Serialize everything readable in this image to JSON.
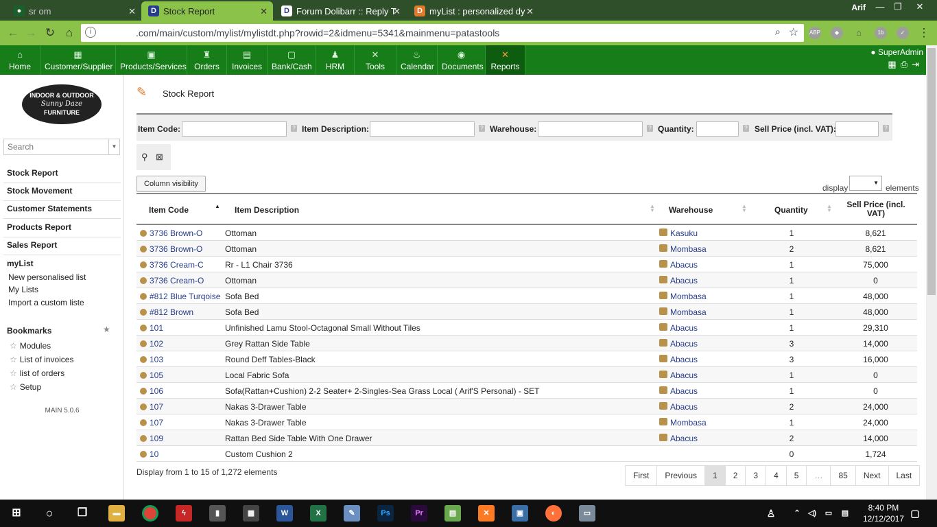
{
  "browser": {
    "tabs": [
      {
        "title": "sr        om"
      },
      {
        "title": "Stock Report"
      },
      {
        "title": "Forum Dolibarr :: Reply T"
      },
      {
        "title": "myList : personalized dy"
      }
    ],
    "user": "Arif",
    "url": ".com/main/custom/mylist/mylistdt.php?rowid=2&idmenu=5341&mainmenu=patastools"
  },
  "topmenu": {
    "items": [
      {
        "label": "Home",
        "icon": "home-icon"
      },
      {
        "label": "Customer/Supplier",
        "icon": "building-icon"
      },
      {
        "label": "Products/Services",
        "icon": "boxes-icon"
      },
      {
        "label": "Orders",
        "icon": "bottle-icon"
      },
      {
        "label": "Invoices",
        "icon": "invoice-icon"
      },
      {
        "label": "Bank/Cash",
        "icon": "safe-icon"
      },
      {
        "label": "HRM",
        "icon": "users-icon"
      },
      {
        "label": "Tools",
        "icon": "tools-icon"
      },
      {
        "label": "Calendar",
        "icon": "calendar-icon"
      },
      {
        "label": "Documents",
        "icon": "documents-icon"
      },
      {
        "label": "Reports",
        "icon": "reports-icon"
      }
    ],
    "user": "SuperAdmin"
  },
  "sidebar": {
    "logo": {
      "line1": "INDOOR & OUTDOOR",
      "line2": "Sunny Daze",
      "line3": "FURNITURE"
    },
    "search_placeholder": "Search",
    "main_items": [
      "Stock Report",
      "Stock Movement",
      "Customer Statements",
      "Products Report",
      "Sales Report"
    ],
    "mylist_title": "myList",
    "mylist_items": [
      "New personalised list",
      "My Lists",
      "Import a custom liste"
    ],
    "bookmarks_title": "Bookmarks",
    "bookmarks": [
      "Modules",
      "List of invoices",
      "list of orders",
      "Setup"
    ],
    "version": "MAIN 5.0.6"
  },
  "page": {
    "title": "Stock Report",
    "filters": {
      "item_code": "Item Code:",
      "item_description": "Item Description:",
      "warehouse": "Warehouse:",
      "quantity": "Quantity:",
      "sell_price": "Sell Price (incl. VAT):"
    },
    "column_visibility": "Column visibility",
    "display_label": "display",
    "elements_label": "elements",
    "columns": {
      "item_code": "Item Code",
      "item_description": "Item Description",
      "warehouse": "Warehouse",
      "quantity": "Quantity",
      "sell_price": "Sell Price (incl. VAT)"
    },
    "rows": [
      {
        "code": "3736 Brown-O",
        "desc": "Ottoman",
        "wh": "Kasuku",
        "qty": "1",
        "price": "8,621"
      },
      {
        "code": "3736 Brown-O",
        "desc": "Ottoman",
        "wh": "Mombasa",
        "qty": "2",
        "price": "8,621"
      },
      {
        "code": "3736 Cream-C",
        "desc": "Rr - L1 Chair 3736",
        "wh": "Abacus",
        "qty": "1",
        "price": "75,000"
      },
      {
        "code": "3736 Cream-O",
        "desc": "Ottoman",
        "wh": "Abacus",
        "qty": "1",
        "price": "0"
      },
      {
        "code": "#812 Blue Turqoise",
        "desc": "Sofa Bed",
        "wh": "Mombasa",
        "qty": "1",
        "price": "48,000"
      },
      {
        "code": "#812 Brown",
        "desc": "Sofa Bed",
        "wh": "Mombasa",
        "qty": "1",
        "price": "48,000"
      },
      {
        "code": "101",
        "desc": "Unfinished Lamu Stool-Octagonal Small Without Tiles",
        "wh": "Abacus",
        "qty": "1",
        "price": "29,310"
      },
      {
        "code": "102",
        "desc": "Grey Rattan Side Table",
        "wh": "Abacus",
        "qty": "3",
        "price": "14,000"
      },
      {
        "code": "103",
        "desc": "Round Deff Tables-Black",
        "wh": "Abacus",
        "qty": "3",
        "price": "16,000"
      },
      {
        "code": "105",
        "desc": "Local Fabric Sofa",
        "wh": "Abacus",
        "qty": "1",
        "price": "0"
      },
      {
        "code": "106",
        "desc": "Sofa(Rattan+Cushion) 2-2 Seater+ 2-Singles-Sea Grass Local ( Arif'S Personal) - SET",
        "wh": "Abacus",
        "qty": "1",
        "price": "0"
      },
      {
        "code": "107",
        "desc": "Nakas 3-Drawer Table",
        "wh": "Abacus",
        "qty": "2",
        "price": "24,000"
      },
      {
        "code": "107",
        "desc": "Nakas 3-Drawer Table",
        "wh": "Mombasa",
        "qty": "1",
        "price": "24,000"
      },
      {
        "code": "109",
        "desc": "Rattan Bed Side Table With One Drawer",
        "wh": "Abacus",
        "qty": "2",
        "price": "14,000"
      },
      {
        "code": "10",
        "desc": "Custom Cushion 2",
        "wh": "",
        "qty": "0",
        "price": "1,724"
      }
    ],
    "record_info": "Display from 1 to 15 of 1,272 elements",
    "pager": [
      "First",
      "Previous",
      "1",
      "2",
      "3",
      "4",
      "5",
      "…",
      "85",
      "Next",
      "Last"
    ]
  },
  "taskbar": {
    "time": "8:40 PM",
    "date": "12/12/2017"
  }
}
